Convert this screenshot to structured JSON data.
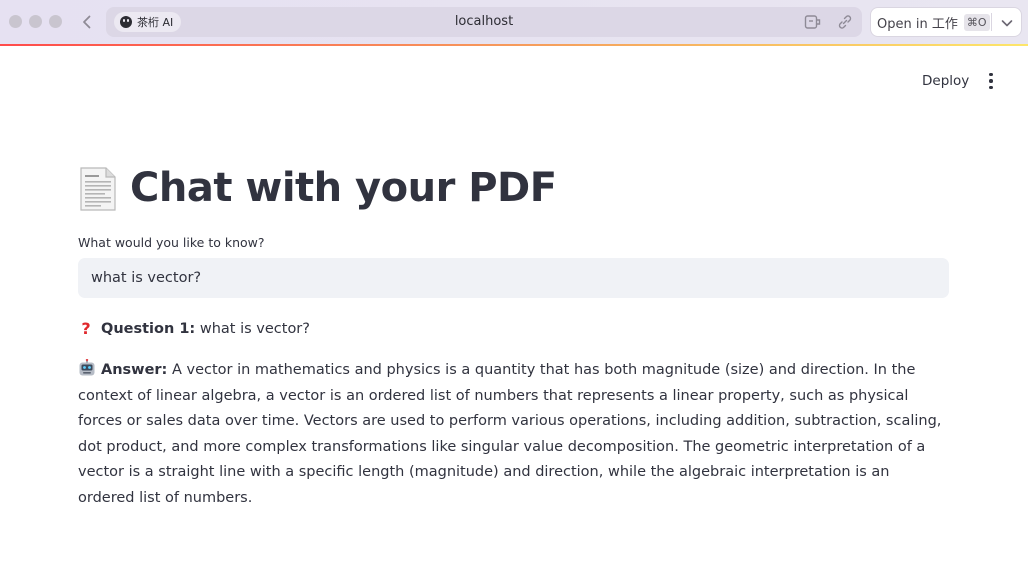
{
  "browser": {
    "url": "localhost",
    "profile_label": "茶桁 AI",
    "open_in_label": "Open in 工作",
    "open_in_shortcut": "⌘O"
  },
  "header": {
    "deploy_label": "Deploy",
    "menu_icon": "more-vertical-icon"
  },
  "main": {
    "title_icon": "page-facing-up-icon",
    "title": "Chat with your PDF",
    "input_label": "What would you like to know?",
    "input_value": "what is vector?",
    "question": {
      "icon": "red-question-mark-icon",
      "label": "Question 1:",
      "text": " what is vector?"
    },
    "answer": {
      "icon": "robot-face-icon",
      "label": "Answer:",
      "text": " A vector in mathematics and physics is a quantity that has both magnitude (size) and direction. In the context of linear algebra, a vector is an ordered list of numbers that represents a linear property, such as physical forces or sales data over time. Vectors are used to perform various operations, including addition, subtraction, scaling, dot product, and more complex transformations like singular value decomposition. The geometric interpretation of a vector is a straight line with a specific length (magnitude) and direction, while the algebraic interpretation is an ordered list of numbers."
    }
  }
}
